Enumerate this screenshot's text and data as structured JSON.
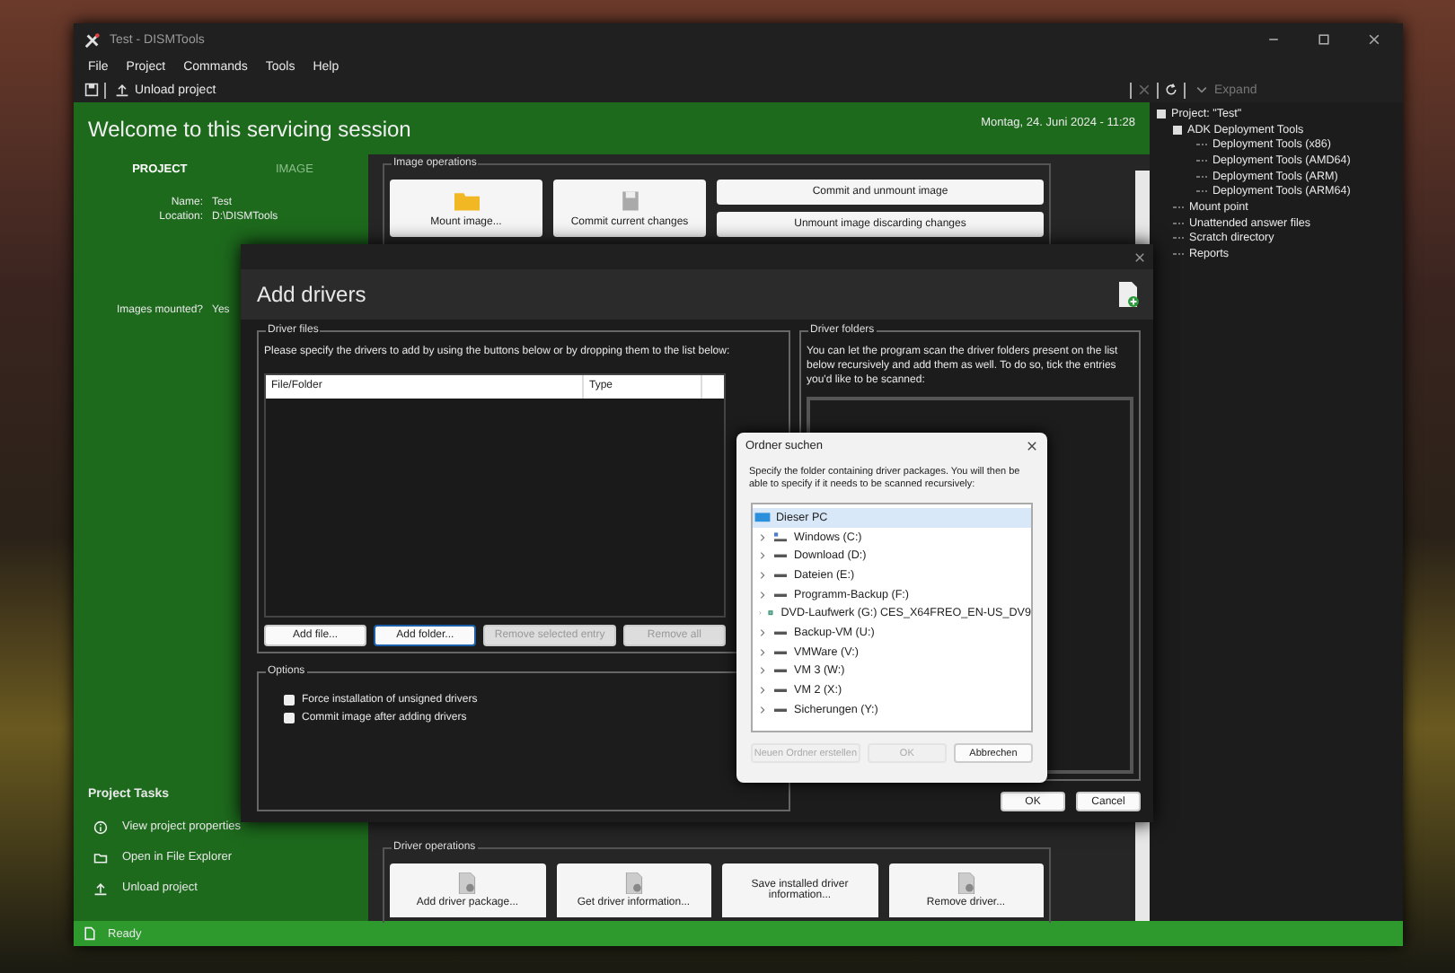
{
  "main_window": {
    "title": "Test - DISMTools",
    "menu": [
      "File",
      "Project",
      "Commands",
      "Tools",
      "Help"
    ],
    "toolbar": {
      "unload": "Unload project",
      "expand": "Expand"
    },
    "header": {
      "title": "Welcome to this servicing session",
      "date": "Montag, 24. Juni 2024 - 11:28"
    },
    "session_tabs": [
      {
        "label": "PROJECT",
        "selected": true
      },
      {
        "label": "IMAGE",
        "selected": false
      }
    ],
    "project_info": [
      {
        "label": "Name:",
        "value": "Test"
      },
      {
        "label": "Location:",
        "value": "D:\\DISMTools"
      }
    ],
    "images_mounted": {
      "label": "Images mounted?",
      "value": "Yes"
    },
    "project_tasks": {
      "title": "Project Tasks",
      "items": [
        "View project properties",
        "Open in File Explorer",
        "Unload project"
      ]
    },
    "image_operations": {
      "title": "Image operations",
      "buttons": [
        "Mount image...",
        "Commit current changes"
      ],
      "wide_buttons": [
        "Commit and unmount image",
        "Unmount image discarding changes"
      ]
    },
    "driver_operations": {
      "title": "Driver operations",
      "buttons": [
        "Add driver package...",
        "Get driver information...",
        "Save installed driver information...",
        "Remove driver..."
      ]
    },
    "tree": [
      {
        "label": "Project: \"Test\"",
        "expanded": true,
        "children": [
          {
            "label": "ADK Deployment Tools",
            "expanded": true,
            "children": [
              {
                "label": "Deployment Tools (x86)"
              },
              {
                "label": "Deployment Tools (AMD64)"
              },
              {
                "label": "Deployment Tools (ARM)"
              },
              {
                "label": "Deployment Tools (ARM64)"
              }
            ]
          },
          {
            "label": "Mount point"
          },
          {
            "label": "Unattended answer files"
          },
          {
            "label": "Scratch directory"
          },
          {
            "label": "Reports"
          }
        ]
      }
    ],
    "status": "Ready"
  },
  "add_drivers": {
    "title": "Add drivers",
    "driver_files": {
      "title": "Driver files",
      "hint": "Please specify the drivers to add by using the buttons below or by dropping them to the list below:",
      "columns": [
        "File/Folder",
        "Type"
      ],
      "buttons": [
        {
          "label": "Add file...",
          "disabled": false
        },
        {
          "label": "Add folder...",
          "disabled": false
        },
        {
          "label": "Remove selected entry",
          "disabled": true
        },
        {
          "label": "Remove all",
          "disabled": true
        }
      ]
    },
    "options": {
      "title": "Options",
      "items": [
        {
          "label": "Force installation of unsigned drivers",
          "checked": false
        },
        {
          "label": "Commit image after adding drivers",
          "checked": false
        }
      ]
    },
    "driver_folders": {
      "title": "Driver folders",
      "hint": "You can let the program scan the driver folders present on the list below recursively and add them as well. To do so, tick the entries you'd like to be scanned:"
    },
    "buttons": [
      "OK",
      "Cancel"
    ]
  },
  "folder_dialog": {
    "title": "Ordner suchen",
    "hint": "Specify the folder containing driver packages. You will then be able to specify if it needs to be scanned recursively:",
    "root": {
      "label": "Dieser PC",
      "selected": true,
      "children": [
        {
          "label": "Windows (C:)",
          "kind": "system",
          "selected": false,
          "expanded": false
        },
        {
          "label": "Download (D:)",
          "kind": "drive",
          "selected": false,
          "expanded": false
        },
        {
          "label": "Dateien (E:)",
          "kind": "drive",
          "selected": false,
          "expanded": false
        },
        {
          "label": "Programm-Backup (F:)",
          "kind": "drive",
          "selected": false,
          "expanded": false
        },
        {
          "label": "DVD-Laufwerk (G:) CES_X64FREO_EN-US_DV9",
          "kind": "dvd",
          "selected": false,
          "expanded": false
        },
        {
          "label": "Backup-VM (U:)",
          "kind": "drive",
          "selected": false,
          "expanded": false
        },
        {
          "label": "VMWare (V:)",
          "kind": "drive",
          "selected": false,
          "expanded": false
        },
        {
          "label": "VM 3 (W:)",
          "kind": "drive",
          "selected": false,
          "expanded": false
        },
        {
          "label": "VM 2 (X:)",
          "kind": "drive",
          "selected": false,
          "expanded": false
        },
        {
          "label": "Sicherungen (Y:)",
          "kind": "drive",
          "selected": false,
          "expanded": false
        }
      ]
    },
    "buttons": [
      {
        "label": "Neuen Ordner erstellen",
        "disabled": true
      },
      {
        "label": "OK",
        "disabled": true
      },
      {
        "label": "Abbrechen",
        "disabled": false
      }
    ]
  }
}
